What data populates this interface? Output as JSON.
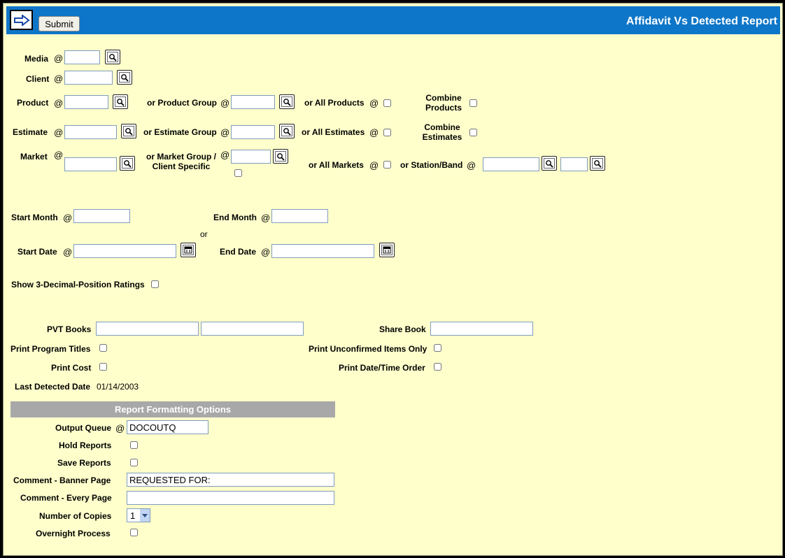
{
  "header": {
    "title": "Affidavit Vs Detected Report",
    "submit_label": "Submit",
    "bg_color": "#0e76c8"
  },
  "labels": {
    "at": "@",
    "media": "Media",
    "client": "Client",
    "product": "Product",
    "product_group": "or Product Group",
    "all_products": "or All Products",
    "combine_products_1": "Combine",
    "combine_products_2": "Products",
    "estimate": "Estimate",
    "estimate_group": "or Estimate Group",
    "all_estimates": "or All Estimates",
    "combine_estimates_1": "Combine",
    "combine_estimates_2": "Estimates",
    "market": "Market",
    "market_group_1": "or Market Group /",
    "market_group_2": "Client Specific",
    "all_markets": "or All Markets",
    "station_band": "or Station/Band",
    "start_month": "Start Month",
    "end_month": "End Month",
    "or": "or",
    "start_date": "Start Date",
    "end_date": "End Date",
    "show_3_decimal": "Show 3-Decimal-Position Ratings",
    "pvt_books": "PVT Books",
    "share_book": "Share Book",
    "print_program_titles": "Print Program Titles",
    "print_unconfirmed": "Print Unconfirmed Items Only",
    "print_cost": "Print Cost",
    "print_date_time": "Print Date/Time Order",
    "last_detected_date": "Last Detected Date",
    "last_detected_value": "01/14/2003"
  },
  "formatting": {
    "section_title": "Report Formatting Options",
    "output_queue": "Output Queue",
    "output_queue_value": "DOCOUTQ",
    "hold_reports": "Hold Reports",
    "save_reports": "Save Reports",
    "comment_banner": "Comment - Banner Page",
    "comment_banner_value": "REQUESTED FOR:",
    "comment_every": "Comment - Every Page",
    "comment_every_value": "",
    "copies": "Number of Copies",
    "copies_value": "1",
    "overnight": "Overnight Process"
  },
  "icons": {
    "lookup": "magnifier-lookup-icon",
    "calendar": "calendar-icon",
    "nav": "arrow-right-icon"
  }
}
